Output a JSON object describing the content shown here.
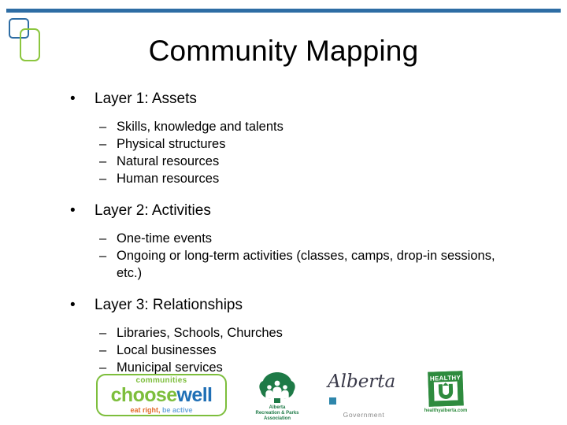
{
  "slide": {
    "title": "Community Mapping",
    "accent_blue": "#2E6DA4",
    "accent_green": "#8CC63F"
  },
  "content": {
    "layers": [
      {
        "heading": "Layer 1: Assets",
        "items": [
          "Skills, knowledge and talents",
          "Physical structures",
          "Natural resources",
          "Human resources"
        ]
      },
      {
        "heading": "Layer 2: Activities",
        "items": [
          "One-time events",
          "Ongoing or long-term activities (classes, camps, drop-in sessions, etc.)"
        ]
      },
      {
        "heading": "Layer 3: Relationships",
        "items": [
          "Libraries, Schools, Churches",
          "Local businesses",
          "Municipal services"
        ]
      }
    ],
    "bullet_glyph": "•",
    "dash_glyph": "–"
  },
  "footer_logos": {
    "choosewell": {
      "top_text": "communities",
      "main_first": "choose",
      "main_second": "well",
      "tagline_first": "eat right,",
      "tagline_second": " be active",
      "color_green": "#7DBE3C",
      "color_blue": "#1F6FB5",
      "color_orange": "#E36C2B"
    },
    "arpa": {
      "line1": "Alberta",
      "line2": "Recreation & Parks",
      "line3": "Association",
      "color": "#1E7A47"
    },
    "alberta_government": {
      "wordmark": "Alberta",
      "subtitle": "Government",
      "square_color": "#2E86AB"
    },
    "healthy_u": {
      "label": "HEALTHY",
      "letter": "U",
      "url": "healthyalberta.com",
      "color": "#2E8B3E"
    }
  }
}
